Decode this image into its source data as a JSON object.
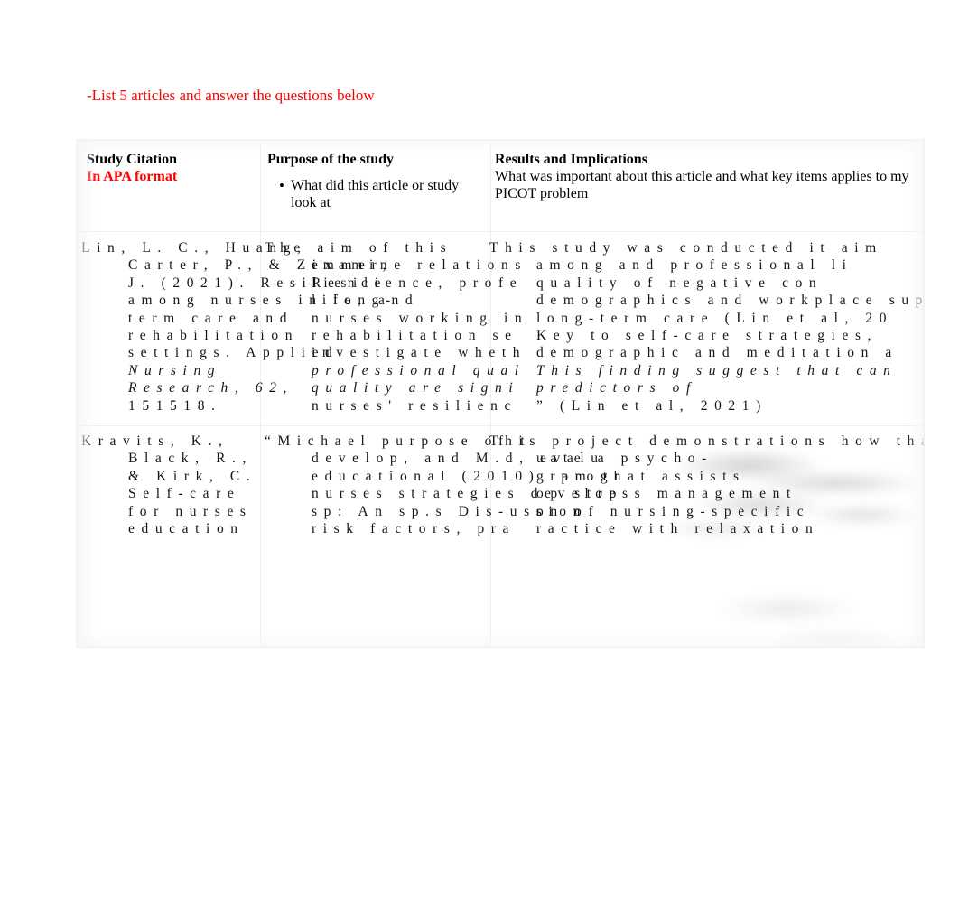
{
  "document": {
    "intro_note": "-List 5 articles and answer the questions below"
  },
  "table": {
    "headers": {
      "col1": {
        "title": "Study Citation",
        "subtitle_red": "In APA format"
      },
      "col2": {
        "title": "Purpose of the study",
        "bullet_marker": "•",
        "bullet": "What did this article or study look at"
      },
      "col3": {
        "title": "Results and Implications",
        "subtitle": "What was important about this article and what key items applies to my PICOT problem"
      }
    },
    "rows": [
      {
        "citation": [
          "Lin, L. C., Huang,",
          "Carter, P., & Zimmer,",
          "J. (2021). Resilience",
          "among nurses in long-",
          "term care and",
          "rehabilitation",
          "settings. Applied",
          "Nursing",
          "Research, 62,",
          "151518."
        ],
        "citation_italic_lines": [
          7,
          8
        ],
        "purpose": [
          "The aim of this",
          "examine relations",
          "Resilience, profe",
          "life, and",
          "nurses working in",
          "rehabilitation se",
          "investigate wheth",
          "professional qual",
          "quality are signi",
          "nurses' resilienc"
        ],
        "results": [
          "This study was conducted it aim",
          "among and professional li",
          "quality of negative con",
          "demographics and workplace sup",
          "long-term care (Lin et al, 20",
          "Key to self-care strategies,",
          "demographic and meditation a",
          "This finding suggest that can",
          "predictors of",
          "” (Lin et al, 2021)"
        ]
      },
      {
        "citation": [
          "Kravits, K.,",
          "Black, R.,",
          "& Kirk, C.",
          "Self-care",
          "for nurses",
          "education",
          ""
        ],
        "purpose": [
          "“Michael purpose of t",
          "develop, and M.d, evalu",
          "educational (2010). progr",
          "nurses strategies develop",
          "sp: An sp.s Dis-ussion",
          "risk factors, pra",
          ""
        ],
        "results": [
          "This project demonstrations how tha",
          "uate a psycho-",
          "gram that assists",
          "op stress management",
          "on of nursing-specific",
          "ractice with relaxation",
          ""
        ]
      }
    ]
  },
  "colors": {
    "accent_red": "#ff0000",
    "text": "#151515",
    "page_background": "#ffffff",
    "table_rule": "#efeeee"
  }
}
